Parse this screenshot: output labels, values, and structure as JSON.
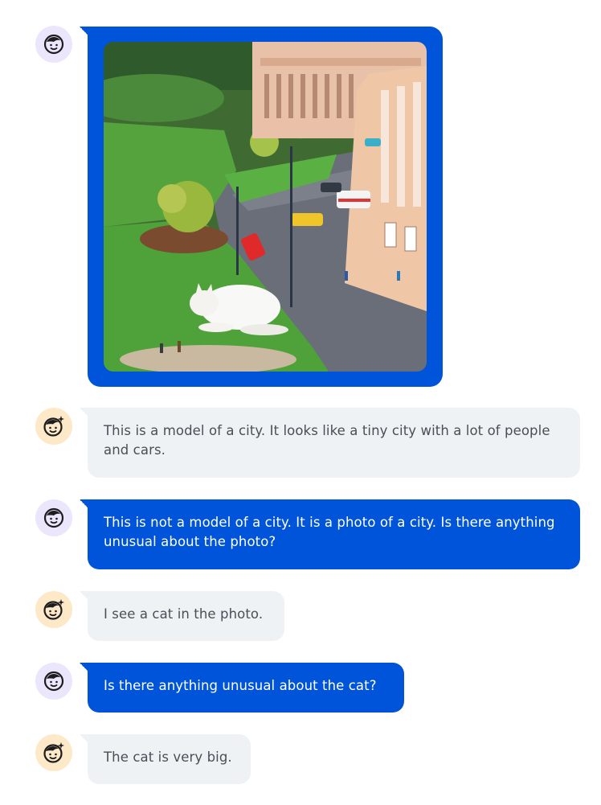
{
  "chat": {
    "photo": {
      "subject": "miniature-city-with-white-cat",
      "icon": "photo-image"
    },
    "messages": [
      {
        "role": "bot",
        "text": "This is a model of a city. It looks like a tiny city with a lot of people and cars."
      },
      {
        "role": "user",
        "text": "This is not a model of a city.  It is a photo of a city.  Is there anything unusual about the photo?"
      },
      {
        "role": "bot",
        "text": "I see a cat in the photo."
      },
      {
        "role": "user",
        "text": "Is there anything unusual about the cat?"
      },
      {
        "role": "bot",
        "text": "The cat is very big."
      }
    ]
  },
  "colors": {
    "user_bubble": "#0054d9",
    "bot_bubble": "#eff2f5",
    "user_avatar_bg": "#ebe6fb",
    "bot_avatar_bg": "#fde8c8"
  },
  "icons": {
    "user_avatar": "face-icon",
    "bot_avatar": "face-sparkle-icon"
  }
}
